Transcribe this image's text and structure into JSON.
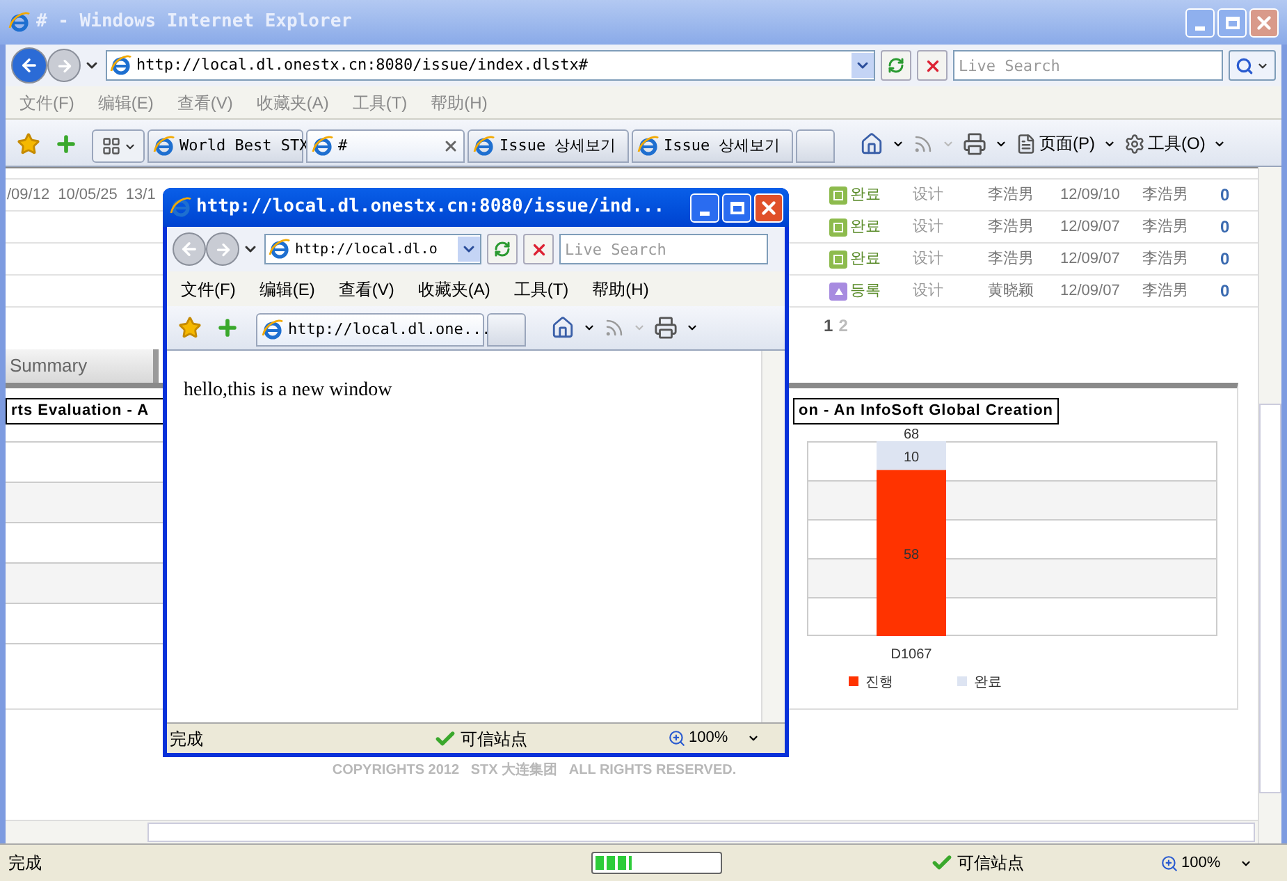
{
  "window": {
    "title": "# - Windows Internet Explorer"
  },
  "address_bar": {
    "url": "http://local.dl.onestx.cn:8080/issue/index.dlstx#",
    "search_placeholder": "Live Search"
  },
  "menu": [
    "文件(F)",
    "编辑(E)",
    "查看(V)",
    "收藏夹(A)",
    "工具(T)",
    "帮助(H)"
  ],
  "tabs": [
    {
      "label": "World Best STX",
      "selected": false
    },
    {
      "label": "#",
      "selected": true
    },
    {
      "label": "Issue 상세보기",
      "selected": false
    },
    {
      "label": "Issue 상세보기",
      "selected": false
    }
  ],
  "command_bar": {
    "page": "页面(P)",
    "tools": "工具(O)"
  },
  "table": {
    "rows": [
      {
        "left_cells": [
          "/09/12",
          "10/05/25",
          "13/1"
        ],
        "kind": "done",
        "status": "완료",
        "type": "设计",
        "owner": "李浩男",
        "date": "12/09/10",
        "assignee": "李浩男",
        "count": "0"
      },
      {
        "kind": "done",
        "status": "완료",
        "type": "设计",
        "owner": "李浩男",
        "date": "12/09/07",
        "assignee": "李浩男",
        "count": "0"
      },
      {
        "kind": "done",
        "status": "완료",
        "type": "设计",
        "owner": "李浩男",
        "date": "12/09/07",
        "assignee": "李浩男",
        "count": "0"
      },
      {
        "kind": "registered",
        "status": "등록",
        "type": "设计",
        "owner": "黄晓颖",
        "date": "12/09/07",
        "assignee": "李浩男",
        "count": "0"
      }
    ]
  },
  "pagination": [
    {
      "label": "1",
      "selected": true
    },
    {
      "label": "2",
      "selected": false
    }
  ],
  "summary_tab": {
    "label": "Summary"
  },
  "left_chart": {
    "title": "rts Evaluation - A"
  },
  "right_chart": {
    "title": "on - An InfoSoft Global Creation",
    "chart_data": {
      "type": "bar",
      "stacked": true,
      "categories": [
        "D1067"
      ],
      "series": [
        {
          "name": "진행",
          "color": "#ff3300",
          "values": [
            58
          ]
        },
        {
          "name": "완료",
          "color": "#dde4f2",
          "values": [
            10
          ]
        }
      ],
      "data_labels": true,
      "annotations": [
        "68"
      ],
      "legend": "bottom"
    }
  },
  "footer": "COPYRIGHTS 2012   STX 大连集团   ALL RIGHTS RESERVED.",
  "status_bar": {
    "text": "完成",
    "progress": {
      "level": 0.3
    },
    "zone": "可信站点",
    "zoom": "100%"
  },
  "popup": {
    "title": "http://local.dl.onestx.cn:8080/issue/ind...",
    "url": "http://local.dl.o",
    "search_placeholder": "Live Search",
    "menu": [
      "文件(F)",
      "编辑(E)",
      "查看(V)",
      "收藏夹(A)",
      "工具(T)",
      "帮助(H)"
    ],
    "tab": {
      "label": "http://local.dl.one...",
      "selected": true
    },
    "content": "hello,this is a new window",
    "status_bar": {
      "text": "完成",
      "zone": "可信站点",
      "zoom": "100%"
    }
  }
}
